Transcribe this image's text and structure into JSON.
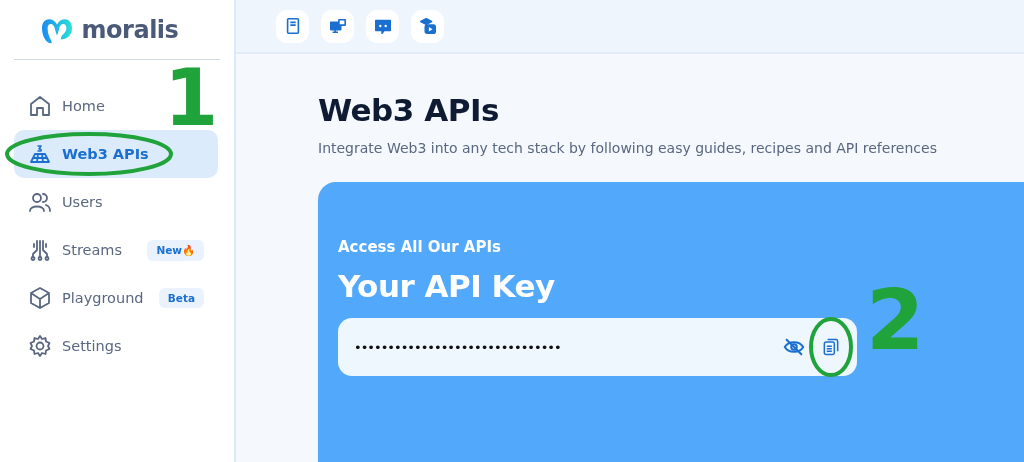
{
  "logo": {
    "text": "moralis"
  },
  "sidebar": {
    "items": [
      {
        "label": "Home",
        "selected": false
      },
      {
        "label": "Web3 APIs",
        "selected": true
      },
      {
        "label": "Users",
        "selected": false
      },
      {
        "label": "Streams",
        "selected": false,
        "badge": "New",
        "badge_emoji": "🔥"
      },
      {
        "label": "Playground",
        "selected": false,
        "badge": "Beta"
      },
      {
        "label": "Settings",
        "selected": false
      }
    ]
  },
  "page": {
    "title": "Web3 APIs",
    "subtitle": "Integrate Web3 into any tech stack by following easy guides, recipes and API references"
  },
  "api_card": {
    "eyebrow": "Access All Our APIs",
    "title": "Your API Key",
    "masked_key": "•••••••••••••••••••••••••••••••"
  },
  "annotations": [
    "1",
    "2"
  ]
}
